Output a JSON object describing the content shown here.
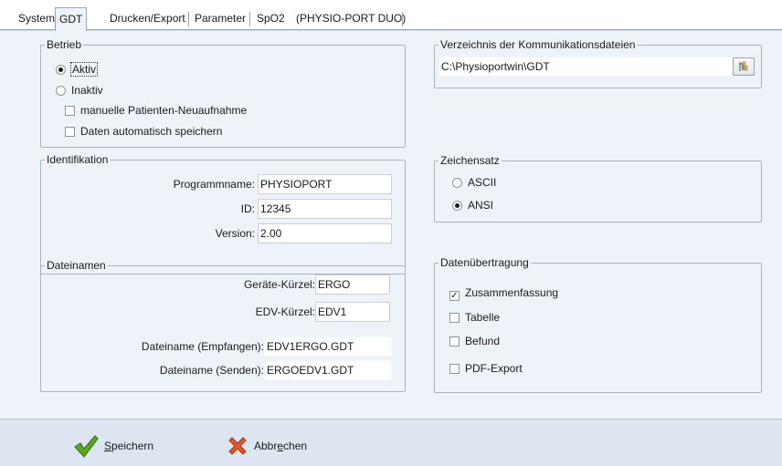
{
  "tabs": [
    {
      "label": "System",
      "active": false
    },
    {
      "label": "GDT",
      "active": true
    },
    {
      "label": "Drucken/Export",
      "active": false
    },
    {
      "label": "Parameter",
      "active": false
    },
    {
      "label": "SpO2",
      "active": false
    },
    {
      "label": "(PHYSIO-PORT DUO)",
      "active": false
    }
  ],
  "betrieb": {
    "title": "Betrieb",
    "aktiv": "Aktiv",
    "inaktiv": "Inaktiv",
    "selected": "Aktiv",
    "manuelle": {
      "label": "manuelle Patienten-Neuaufnahme",
      "checked": false
    },
    "daten": {
      "label": "Daten automatisch speichern",
      "checked": false
    }
  },
  "identifikation": {
    "title": "Identifikation",
    "programmname_label": "Programmname:",
    "programmname_value": "PHYSIOPORT",
    "id_label": "ID:",
    "id_value": "12345",
    "version_label": "Version:",
    "version_value": "2.00"
  },
  "dateinamen": {
    "title": "Dateinamen",
    "geraete_label": "Geräte-Kürzel:",
    "geraete_value": "ERGO",
    "edv_label": "EDV-Kürzel:",
    "edv_value": "EDV1",
    "empfangen_label": "Dateiname (Empfangen):",
    "empfangen_value": "EDV1ERGO.GDT",
    "senden_label": "Dateiname (Senden):",
    "senden_value": "ERGOEDV1.GDT"
  },
  "verzeichnis": {
    "title": "Verzeichnis der Kommunikationsdateien",
    "path": "C:\\Physioportwin\\GDT",
    "browse_icon": "folder-browse-icon"
  },
  "zeichensatz": {
    "title": "Zeichensatz",
    "ascii": "ASCII",
    "ansi": "ANSI",
    "selected": "ANSI"
  },
  "datenuebertragung": {
    "title": "Datenübertragung",
    "items": [
      {
        "label": "Zusammenfassung",
        "checked": true
      },
      {
        "label": "Tabelle",
        "checked": false
      },
      {
        "label": "Befund",
        "checked": false
      },
      {
        "label": "PDF-Export",
        "checked": false
      }
    ]
  },
  "footer": {
    "save_prefix": "",
    "save_mnemonic": "S",
    "save_rest": "peichern",
    "cancel_prefix": "Abbr",
    "cancel_mnemonic": "e",
    "cancel_rest": "chen",
    "save_icon": "checkmark-icon",
    "cancel_icon": "x-icon",
    "colors": {
      "check": "#5aa820",
      "cross": "#e2572a"
    }
  }
}
